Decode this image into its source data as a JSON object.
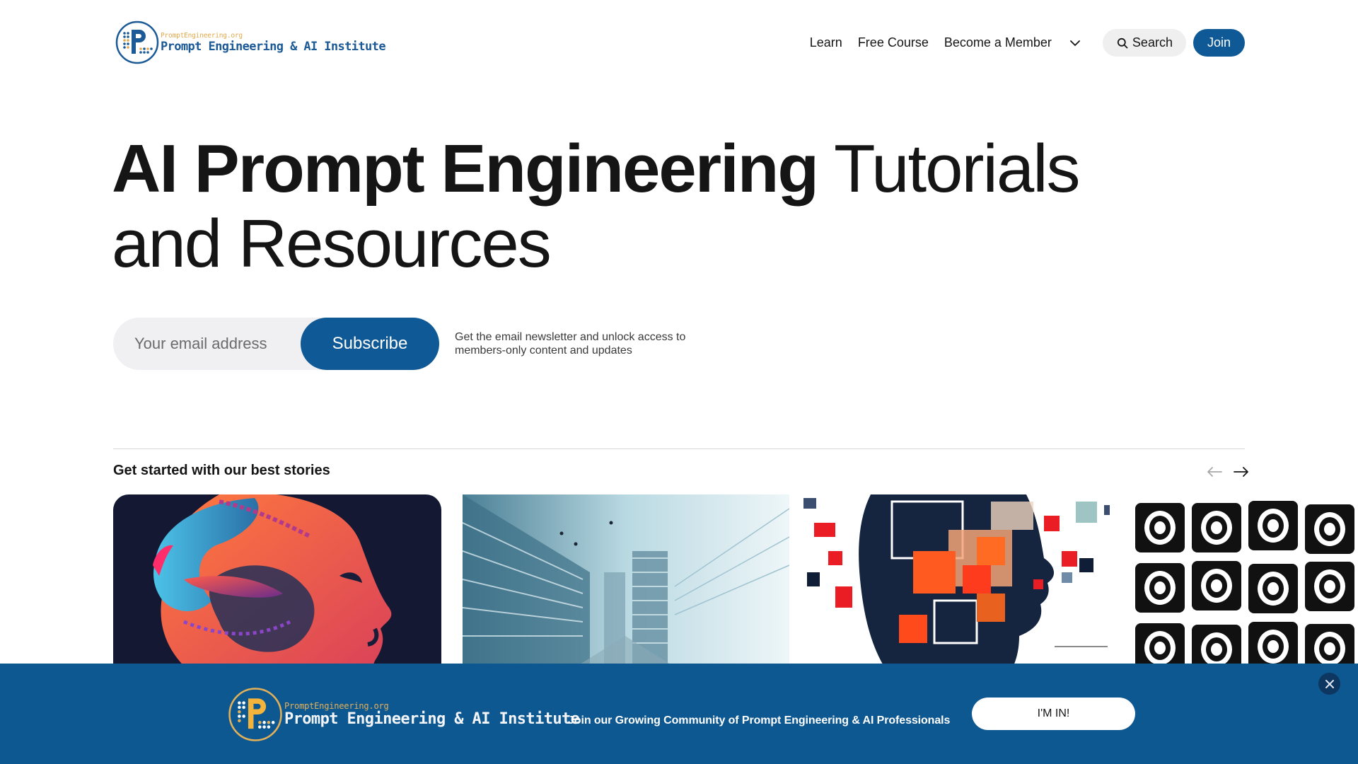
{
  "brand": {
    "site_domain": "PromptEngineering.org",
    "name": "Prompt Engineering & AI Institute",
    "logo_letter": "P",
    "colors": {
      "primary": "#0f5a96",
      "accent_gold": "#e3a94a",
      "banner_bg": "#0e5891",
      "text": "#151515"
    }
  },
  "header": {
    "nav": [
      {
        "label": "Learn"
      },
      {
        "label": "Free Course"
      },
      {
        "label": "Become a Member"
      }
    ],
    "more_icon": "chevron-down-icon",
    "search_label": "Search",
    "search_icon": "search-icon",
    "join_label": "Join"
  },
  "hero": {
    "title_bold": "AI Prompt Engineering",
    "title_light_1": " Tutorials",
    "title_light_2": "and Resources",
    "email_placeholder": "Your email address",
    "email_value": "",
    "subscribe_label": "Subscribe",
    "subscribe_note": "Get the email newsletter and unlock access to members-only content and updates"
  },
  "stories": {
    "title_prefix": "Get started with our ",
    "title_bold": "best stories",
    "prev_icon": "arrow-left-icon",
    "next_icon": "arrow-right-icon",
    "cards": [
      {
        "image": "abstract colorful face profile illustration"
      },
      {
        "image": "futuristic city data visualization"
      },
      {
        "image": "pixelated mosaic head profile"
      },
      {
        "image": "black and white tribal pattern"
      }
    ]
  },
  "banner": {
    "text": "Join our Growing Community of Prompt Engineering & AI Professionals",
    "cta_label": "I'M IN!",
    "close_icon": "close-icon"
  }
}
